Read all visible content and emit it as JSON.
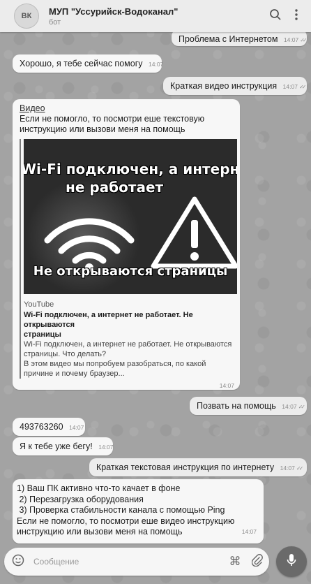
{
  "header": {
    "avatar_text": "ВК",
    "title": "МУП \"Уссурийск-Водоканал\"",
    "subtitle": "бот",
    "search_icon": "search-icon",
    "more_icon": "more-vertical-icon"
  },
  "messages": [
    {
      "dir": "out",
      "text": "Проблема с Интернетом",
      "time": "14:07"
    },
    {
      "dir": "in",
      "text": "Хорошо, я тебе сейчас помогу",
      "time": "14:07"
    },
    {
      "dir": "out",
      "text": "Краткая видео инструкция",
      "time": "14:07"
    },
    {
      "dir": "in",
      "link": "Видео",
      "text_lines": [
        "Если не помогло, то посмотри еше текстовую",
        "инструкцию или вызови меня на помощь"
      ],
      "preview": {
        "thumb_line1": "Wi-Fi подключен, а интернет",
        "thumb_line2": "не работает",
        "thumb_line3": "Не открываются страницы",
        "site": "YouTube",
        "title_lines": [
          "Wi-Fi подключен, а интернет не работает. Не открываются",
          "страницы"
        ],
        "desc_lines": [
          "Wi-Fi подключен, а интернет не работает. Не открываются",
          "страницы. Что делать?",
          "В этом видео мы попробуем разобраться, по какой",
          "причине и почему браузер..."
        ]
      },
      "time": "14:07"
    },
    {
      "dir": "out",
      "text": "Позвать на помощь",
      "time": "14:07"
    },
    {
      "dir": "in",
      "text": "493763260",
      "time": "14:07"
    },
    {
      "dir": "in",
      "text": "Я к тебе уже бегу!",
      "time": "14:07"
    },
    {
      "dir": "out",
      "text": "Краткая текстовая инструкция по интернету",
      "time": "14:07"
    },
    {
      "dir": "in",
      "lines": [
        "1) Ваш ПК активно что-то качает в фоне",
        " 2) Перезагрузка оборудования",
        " 3) Проверка стабильности канала с помощью Ping",
        "Если не помогло, то посмотри еше видео инструкцию",
        "инструкцию или вызови меня на помощь"
      ],
      "time": "14:07"
    }
  ],
  "input": {
    "placeholder": "Сообщение",
    "emoji_icon": "emoji-icon",
    "command_icon": "command-icon",
    "attach_icon": "paperclip-icon",
    "mic_icon": "microphone-icon"
  },
  "colors": {
    "background": "#a3a3a3",
    "incoming_bubble": "#f7f7f7",
    "outgoing_bubble": "#ececec",
    "mic_button": "#6a6a6a"
  }
}
